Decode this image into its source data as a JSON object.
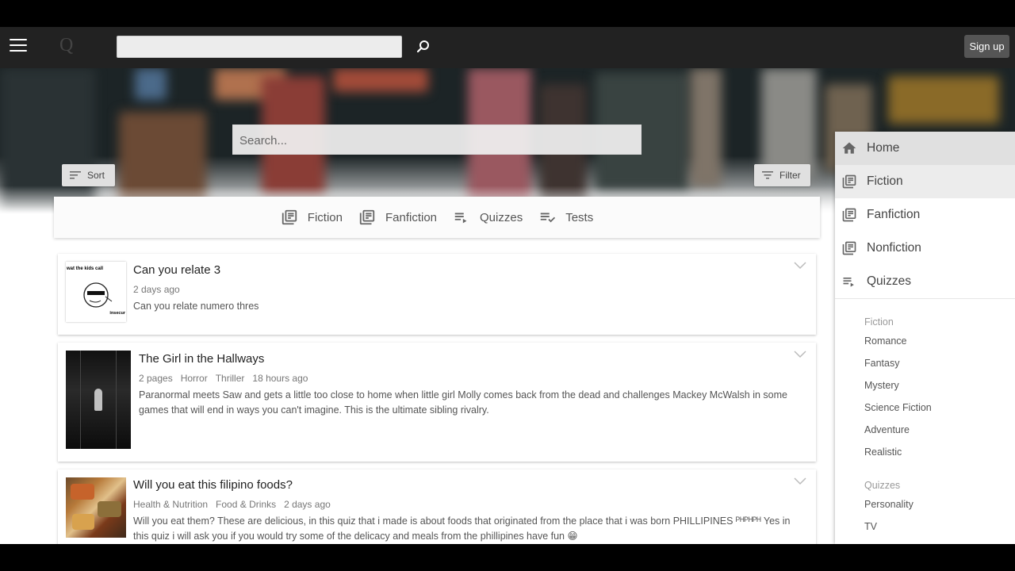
{
  "topbar": {
    "logo": "Q",
    "search_value": "",
    "signup_label": "Sign up"
  },
  "hero": {
    "search_placeholder": "Search...",
    "sort_label": "Sort",
    "filter_label": "Filter"
  },
  "categories": [
    {
      "label": "Fiction",
      "icon": "library-icon"
    },
    {
      "label": "Fanfiction",
      "icon": "library-icon"
    },
    {
      "label": "Quizzes",
      "icon": "playlist-icon"
    },
    {
      "label": "Tests",
      "icon": "playlist-check-icon"
    }
  ],
  "stories": [
    {
      "title": "Can you relate 3",
      "meta": [
        "2 days ago"
      ],
      "description": "Can you relate numero thres",
      "thumb_caption": "wat the kids call",
      "thumb_caption2": "insecur"
    },
    {
      "title": "The Girl in the Hallways",
      "meta": [
        "2 pages",
        "Horror",
        "Thriller",
        "18 hours ago"
      ],
      "description": "Paranormal meets Saw and gets a little too close to home when little girl Molly comes back from the dead and challenges Mackey McWalsh in some games that will end in ways you can't imagine. This is the ultimate sibling rivalry."
    },
    {
      "title": "Will you eat this filipino foods?",
      "meta": [
        "Health & Nutrition",
        "Food & Drinks",
        "2 days ago"
      ],
      "description": "Will you eat them? These are delicious, in this quiz that i made is about foods that originated from the place that i was born PHILLIPINES ᴾᴴᴾᴴᴾᴴ Yes in this quiz i will ask you if you would try some of the delicacy and meals from the phillipines have fun 😁"
    }
  ],
  "sidebar": {
    "nav": [
      {
        "label": "Home",
        "icon": "home-icon"
      },
      {
        "label": "Fiction",
        "icon": "library-icon"
      },
      {
        "label": "Fanfiction",
        "icon": "library-icon"
      },
      {
        "label": "Nonfiction",
        "icon": "library-icon"
      },
      {
        "label": "Quizzes",
        "icon": "playlist-icon"
      }
    ],
    "fiction_heading": "Fiction",
    "fiction_links": [
      "Romance",
      "Fantasy",
      "Mystery",
      "Science Fiction",
      "Adventure",
      "Realistic"
    ],
    "quizzes_heading": "Quizzes",
    "quizzes_links": [
      "Personality",
      "TV"
    ]
  },
  "colors": {
    "topbar": "#222222",
    "active_nav": "#e0e0e0",
    "muted_text": "#777777"
  }
}
